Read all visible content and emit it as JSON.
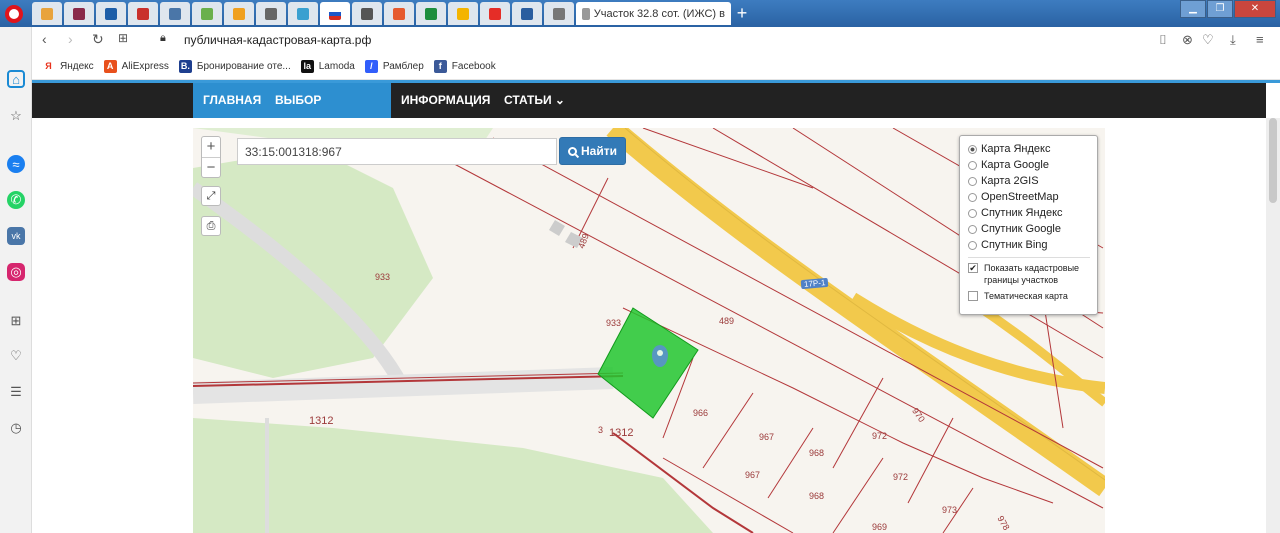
{
  "browser": {
    "active_tab_title": "Участок 32.8 сот. (ИЖС) в",
    "new_tab": "+",
    "address": "публичная-кадастровая-карта.рф",
    "bookmarks": [
      {
        "label": "Яндекс",
        "icon": "Я",
        "color": "#ffffff",
        "fg": "#e8321c"
      },
      {
        "label": "AliExpress",
        "icon": "A",
        "color": "#e8501c",
        "fg": "#ffffff"
      },
      {
        "label": "Бронирование оте...",
        "icon": "B.",
        "color": "#1e3f8f",
        "fg": "#ffffff"
      },
      {
        "label": "Lamoda",
        "icon": "la",
        "color": "#111111",
        "fg": "#ffffff"
      },
      {
        "label": "Рамблер",
        "icon": "/",
        "color": "#315efb",
        "fg": "#ffffff"
      },
      {
        "label": "Facebook",
        "icon": "f",
        "color": "#3b5998",
        "fg": "#ffffff"
      }
    ]
  },
  "site_nav": {
    "home": "ГЛАВНАЯ",
    "region": "ВЫБОР РЕГИОНА ⌄",
    "info": "ИНФОРМАЦИЯ",
    "articles": "СТАТЬИ ⌄"
  },
  "map": {
    "search_value": "33:15:001318:967",
    "search_button": "Найти",
    "zoom_in": "+",
    "zoom_out": "−",
    "layers": [
      {
        "label": "Карта Яндекс",
        "checked": true
      },
      {
        "label": "Карта Google",
        "checked": false
      },
      {
        "label": "Карта 2GIS",
        "checked": false
      },
      {
        "label": "OpenStreetMap",
        "checked": false
      },
      {
        "label": "Спутник Яндекс",
        "checked": false
      },
      {
        "label": "Спутник Google",
        "checked": false
      },
      {
        "label": "Спутник Bing",
        "checked": false
      }
    ],
    "show_boundaries": "Показать кадастровые границы участков",
    "thematic_map": "Тематическая карта",
    "road_badge": "17Р-1",
    "labels": {
      "l933a": "933",
      "l933b": "933",
      "l489a": "489",
      "l489b": "489",
      "l1312a": "1312",
      "l3": "3",
      "l1312b": "1312",
      "l966": "966",
      "l967a": "967",
      "l967b": "967",
      "l968a": "968",
      "l968b": "968",
      "l972a": "972",
      "l972b": "972",
      "l970": "970",
      "l973": "973",
      "l969": "969",
      "l978": "978"
    }
  },
  "colors": {
    "nav_bg": "#222222",
    "nav_active": "#2d8fd0",
    "parcel": "#22c62f",
    "boundary": "#b3373a",
    "road": "#f2c94c"
  }
}
